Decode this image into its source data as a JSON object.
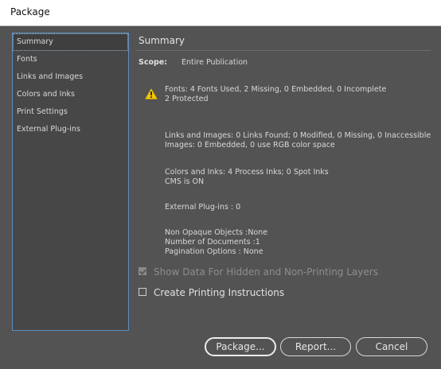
{
  "window": {
    "title": "Package"
  },
  "sidebar": {
    "items": [
      {
        "label": "Summary",
        "selected": true
      },
      {
        "label": "Fonts"
      },
      {
        "label": "Links and Images"
      },
      {
        "label": "Colors and Inks"
      },
      {
        "label": "Print Settings"
      },
      {
        "label": "External Plug-ins"
      }
    ]
  },
  "summary": {
    "title": "Summary",
    "scope_label": "Scope:",
    "scope_value": "Entire Publication",
    "fonts_line1": "Fonts: 4 Fonts Used, 2 Missing, 0 Embedded, 0 Incomplete",
    "fonts_line2": "2 Protected",
    "links_line1": "Links and Images: 0 Links Found; 0 Modified, 0 Missing, 0 Inaccessible",
    "links_line2": "Images: 0 Embedded, 0 use RGB color space",
    "colors_line1": "Colors and Inks: 4 Process Inks; 0 Spot Inks",
    "colors_line2": "CMS is ON",
    "plugins_line": "External Plug-ins : 0",
    "opaque_line": "Non Opaque Objects :None",
    "docs_line": "Number of Documents :1",
    "pagination_line": "Pagination Options : None"
  },
  "options": {
    "show_hidden_label": "Show Data For Hidden and Non-Printing Layers",
    "show_hidden_checked": true,
    "show_hidden_enabled": false,
    "create_instructions_label": "Create Printing Instructions",
    "create_instructions_checked": false
  },
  "buttons": {
    "package": "Package...",
    "report": "Report...",
    "cancel": "Cancel"
  },
  "icons": {
    "warning": "warning-icon",
    "warning_color": "#f5c400"
  }
}
